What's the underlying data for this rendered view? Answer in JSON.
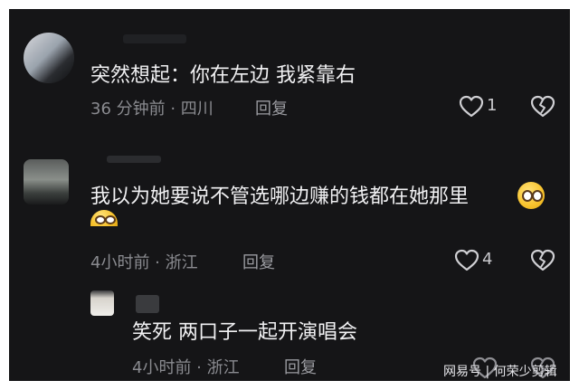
{
  "comments": [
    {
      "text": "突然想起：你在左边 我紧靠右",
      "meta": "36 分钟前 · 四川",
      "reply": "回复",
      "likes": "1"
    },
    {
      "text": "我以为她要说不管选哪边赚的钱都在她那里",
      "meta": "4小时前 · 浙江",
      "reply": "回复",
      "likes": "4"
    },
    {
      "text": "笑死 两口子一起开演唱会",
      "meta": "4小时前 · 浙江",
      "reply": "回复",
      "likes": ""
    }
  ],
  "watermark": "网易号 | 何荣少剪辑",
  "icons": [
    "heart-outline-icon",
    "heart-broken-icon",
    "emoji-grin-icon"
  ]
}
